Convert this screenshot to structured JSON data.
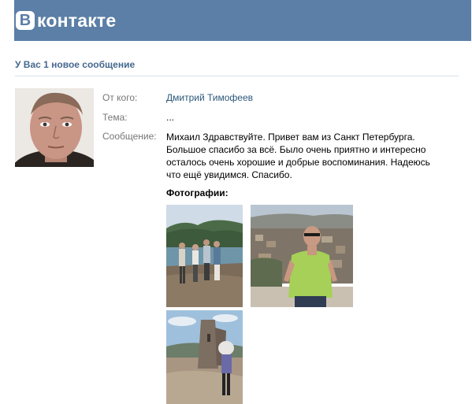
{
  "header": {
    "logo_letter": "В",
    "logo_text": "контакте",
    "brand_color": "#5b7fa6"
  },
  "notice": "У Вас 1 новое сообщение",
  "fields": {
    "from_label": "От кого:",
    "from_value": "Дмитрий Тимофеев",
    "subject_label": "Тема:",
    "subject_value": "...",
    "message_label": "Сообщение:",
    "message_lines": [
      "Михаил Здравствуйте. Привет вам из Санкт Петербурга.",
      "Большое спасибо за всё. Было очень приятно и интересно",
      "осталось очень хорошие и добрые воспоминания. Надеюсь",
      "что ещё увидимся. Спасибо."
    ]
  },
  "photos_label": "Фотографии:",
  "colors": {
    "link": "#2b587a",
    "label": "#777777",
    "notice": "#45688e"
  },
  "icons": [
    "vk-logo-icon"
  ]
}
